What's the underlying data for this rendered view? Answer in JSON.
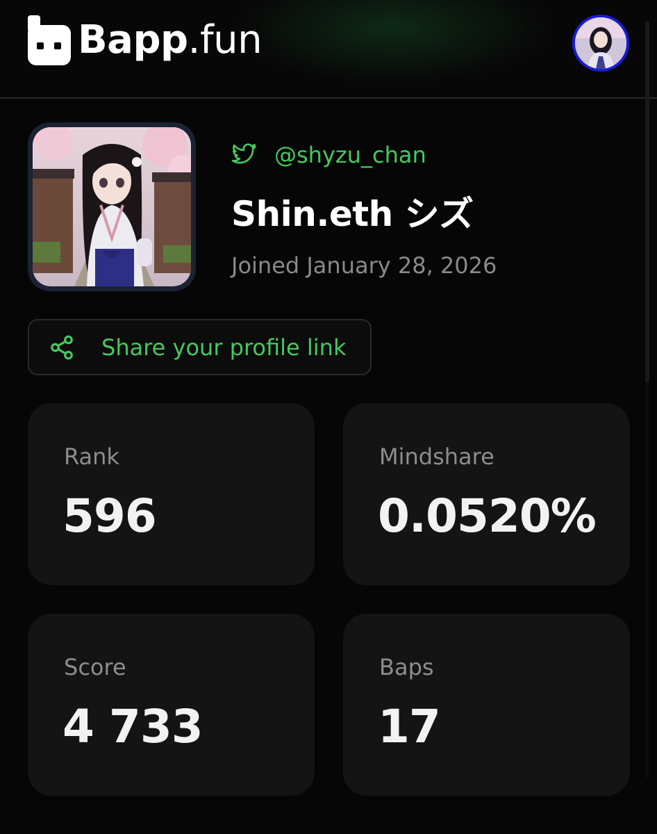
{
  "header": {
    "logo_bold": "Bapp",
    "logo_light": ".fun"
  },
  "profile": {
    "handle": "@shyzu_chan",
    "name": "Shin.eth シズ",
    "joined": "Joined January 28, 2026",
    "share_label": "Share your profile link"
  },
  "stats": [
    {
      "label": "Rank",
      "value": "596"
    },
    {
      "label": "Mindshare",
      "value": "0.0520%"
    },
    {
      "label": "Score",
      "value": "4 733"
    },
    {
      "label": "Baps",
      "value": "17"
    }
  ],
  "colors": {
    "accent_green": "#46c95e",
    "background": "#060606",
    "card": "#141414",
    "avatar_ring": "#1a1ad6"
  },
  "icons": [
    "bapp-logo-icon",
    "user-avatar",
    "twitter-icon",
    "share-icon"
  ]
}
